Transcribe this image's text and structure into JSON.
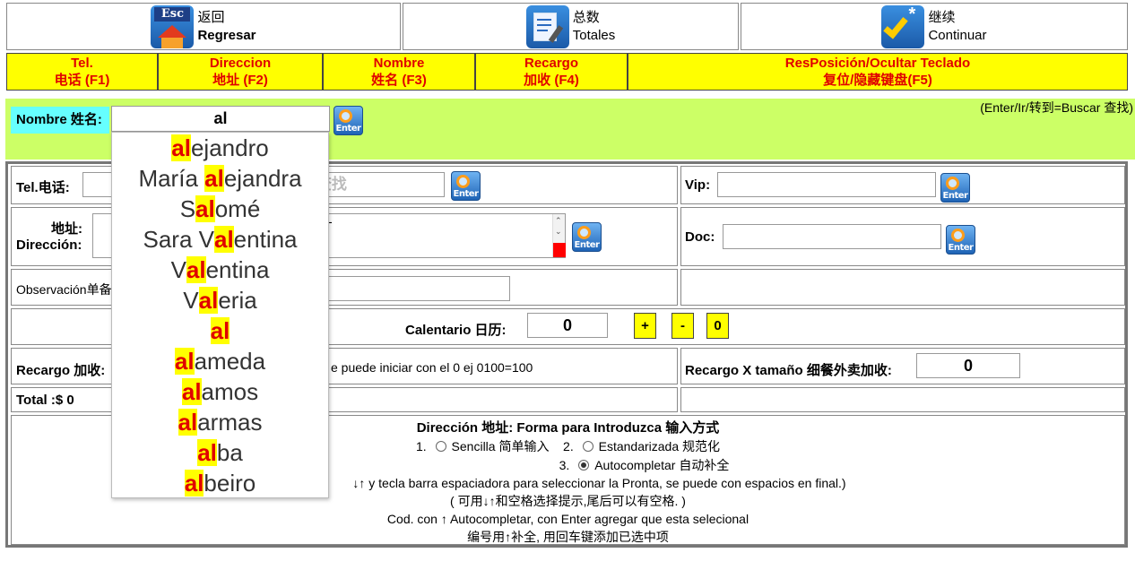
{
  "toolbar": {
    "back": {
      "zh": "返回",
      "es": "Regresar",
      "icon": "esc-home-icon"
    },
    "totals": {
      "zh": "总数",
      "es": "Totales",
      "icon": "document-edit-icon"
    },
    "continue": {
      "zh": "继续",
      "es": "Continuar",
      "icon": "check-icon"
    }
  },
  "shortcuts": [
    {
      "es": "Tel.",
      "zh": "电话 (F1)"
    },
    {
      "es": "Direccion",
      "zh": "地址 (F2)"
    },
    {
      "es": "Nombre",
      "zh": "姓名 (F3)"
    },
    {
      "es": "Recargo",
      "zh": "加收 (F4)"
    },
    {
      "es": "ResPosición/Ocultar Teclado",
      "zh": "复位/隐藏键盘(F5)"
    }
  ],
  "search": {
    "label": "Nombre 姓名:",
    "value": "al",
    "hint": "(Enter/Ir/转到=Buscar 查找)",
    "enter_label": "Enter"
  },
  "autocomplete": {
    "items": [
      {
        "pre": "",
        "hl": "al",
        "post": "ejandro"
      },
      {
        "pre": "María ",
        "hl": "al",
        "post": "ejandra"
      },
      {
        "pre": "S",
        "hl": "al",
        "post": "omé"
      },
      {
        "pre": "Sara V",
        "hl": "al",
        "post": "entina"
      },
      {
        "pre": "V",
        "hl": "al",
        "post": "entina"
      },
      {
        "pre": "V",
        "hl": "al",
        "post": "eria"
      },
      {
        "pre": "",
        "hl": "al",
        "post": ""
      },
      {
        "pre": "",
        "hl": "al",
        "post": "ameda"
      },
      {
        "pre": "",
        "hl": "al",
        "post": "amos"
      },
      {
        "pre": "",
        "hl": "al",
        "post": "armas"
      },
      {
        "pre": "",
        "hl": "al",
        "post": "ba"
      },
      {
        "pre": "",
        "hl": "al",
        "post": "beiro"
      }
    ]
  },
  "form": {
    "tel_label": "Tel.电话:",
    "tel_placeholder_visible": "=查找",
    "vip_label": "Vip:",
    "addr_label_zh": "地址:",
    "addr_label_es": "Dirección:",
    "addr_partial": "-",
    "doc_label": "Doc:",
    "obs_label": "Observación单备",
    "calendar_label": "Calentario 日历:",
    "calendar_value": "0",
    "plus": "+",
    "minus": "-",
    "zero": "0",
    "recargo_label": "Recargo 加收:",
    "recargo_hint": "e puede iniciar con el 0 ej 0100=100",
    "recargo_size_label": "Recargo X tamaño 细餐外卖加收:",
    "recargo_size_value": "0",
    "total": "Total :$ 0"
  },
  "address_mode": {
    "title": "Dirección 地址: Forma para Introduzca 输入方式",
    "opt1": "1.",
    "opt1_label": "Sencilla 简单输入",
    "opt2": "2.",
    "opt2_label": "Estandarizada 规范化",
    "opt3": "3.",
    "opt3_label": "Autocompletar 自动补全",
    "help1": "↓↑ y tecla barra espaciadora para seleccionar la Pronta, se puede con espacios en final.)",
    "help2": "( 可用↓↑和空格选择提示,尾后可以有空格. )",
    "help3": "Cod. con ↑ Autocompletar,   con Enter agregar que esta selecional",
    "help4": "编号用↑补全, 用回车键添加已选中项"
  }
}
